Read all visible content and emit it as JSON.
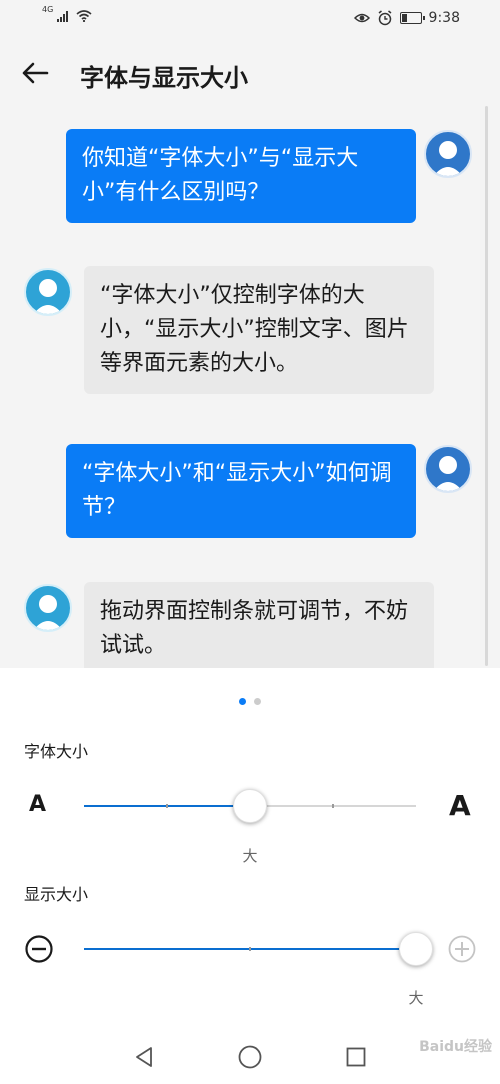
{
  "status_bar": {
    "network": "4G",
    "battery_level": 0.3,
    "time": "9:38"
  },
  "header": {
    "title": "字体与显示大小"
  },
  "preview": {
    "messages": [
      {
        "sender": "me",
        "text": "你知道“字体大小”与“显示大小”有什么区别吗？"
      },
      {
        "sender": "sys",
        "text": "“字体大小”仅控制字体的大小，“显示大小”控制文字、图片等界面元素的大小。"
      },
      {
        "sender": "me",
        "text": "“字体大小”和“显示大小”如何调节？"
      },
      {
        "sender": "sys",
        "text": "拖动界面控制条就可调节，不妨试试。"
      }
    ]
  },
  "pager": {
    "pages": 2,
    "active": 0
  },
  "font_size": {
    "label": "字体大小",
    "small_glyph": "A",
    "large_glyph": "A",
    "value_label": "大",
    "steps": 5,
    "position": 0.5
  },
  "display_size": {
    "label": "显示大小",
    "value_label": "大",
    "steps": 3,
    "position": 1.0,
    "minus_icon": "zoom-out-icon",
    "plus_icon": "zoom-in-icon"
  },
  "navbar": {
    "icons": [
      "back-triangle-icon",
      "home-circle-icon",
      "recents-square-icon"
    ]
  },
  "watermark": "Baidu经验",
  "colors": {
    "accent": "#0a7cf6",
    "slider_fill": "#0a6ed0",
    "bubble_incoming": "#e9e9e9",
    "preview_bg": "#f4f4f4"
  }
}
